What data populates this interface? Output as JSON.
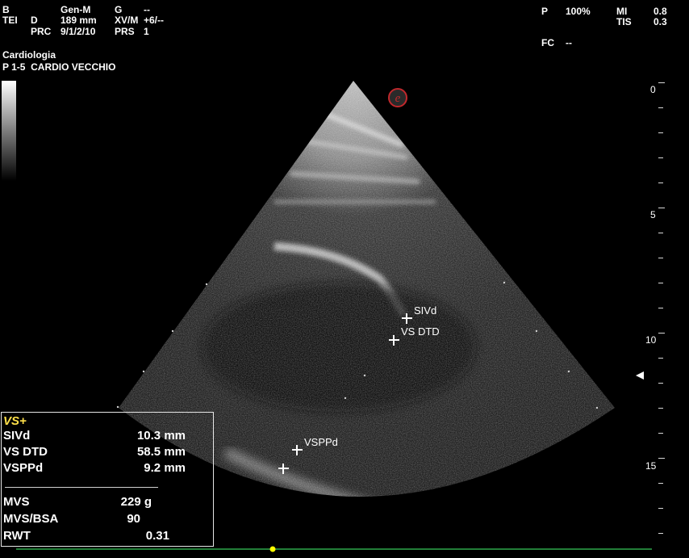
{
  "header": {
    "left": {
      "r1": [
        "B",
        "Gen-M",
        "G",
        "--"
      ],
      "r2": [
        "TEI",
        "D",
        "189 mm",
        "XV/M",
        "+6/--"
      ],
      "r3": [
        "PRC",
        "9/1/2/10",
        "PRS",
        "1"
      ],
      "exam": "Cardiologia",
      "probe": "P 1-5  CARDIO VECCHIO"
    },
    "right": {
      "power_label": "P",
      "power_value": "100%",
      "mi_label": "MI",
      "mi_value": "0.8",
      "tis_label": "TIS",
      "tis_value": "0.3",
      "fc_label": "FC",
      "fc_value": "--"
    }
  },
  "depth_scale": {
    "labels": [
      "0",
      "5",
      "10",
      "15"
    ],
    "unit": "cm",
    "max": 18
  },
  "scan_annotations": {
    "sivd": "SIVd",
    "vs_dtd": "VS DTD",
    "vsppd": "VSPPd"
  },
  "measurements": {
    "title": "VS+",
    "rows": [
      {
        "label": "SIVd",
        "value": "10.3 mm"
      },
      {
        "label": "VS DTD",
        "value": "58.5 mm"
      },
      {
        "label": "VSPPd",
        "value": "9.2 mm"
      }
    ],
    "calc_rows": [
      {
        "label": "MVS",
        "value": "229 g"
      },
      {
        "label": "MVS/BSA",
        "value": "90"
      },
      {
        "label": "RWT",
        "value": "0.31"
      }
    ]
  },
  "icons": {
    "logo": "e-logo-icon",
    "focus_marker": "focus-marker-icon",
    "ecg_marker": "ecg-marker-icon"
  },
  "colors": {
    "background": "#000000",
    "measure_title": "#ffe04a",
    "ecg_trace": "#2ea84a",
    "ecg_marker": "#ffff00",
    "logo_red": "#c0282c"
  }
}
